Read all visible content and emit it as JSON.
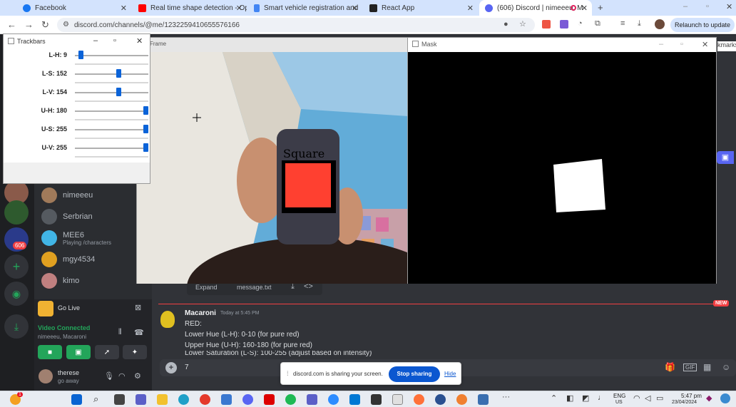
{
  "tabs": [
    {
      "title": "Facebook",
      "color": "#1877f2"
    },
    {
      "title": "Real time shape detection - Op",
      "color": "#ff0000"
    },
    {
      "title": "Smart vehicle registration and",
      "color": "#4285f4"
    },
    {
      "title": "React App",
      "color": "#222222"
    },
    {
      "title": "(606) Discord | nimeeeu, M",
      "color": "#5865f2"
    }
  ],
  "browser": {
    "url": "discord.com/channels/@me/1232259410655576166",
    "relaunch_label": "Relaunch to update",
    "bookmarks_label": "kmarks"
  },
  "trackbars": {
    "title": "Trackbars",
    "items": [
      {
        "label": "L-H: 9",
        "fraction": 0.05
      },
      {
        "label": "L-S: 152",
        "fraction": 0.6
      },
      {
        "label": "L-V: 154",
        "fraction": 0.6
      },
      {
        "label": "U-H: 180",
        "fraction": 1.0
      },
      {
        "label": "U-S: 255",
        "fraction": 1.0
      },
      {
        "label": "U-V: 255",
        "fraction": 1.0
      }
    ]
  },
  "frame_window": {
    "title": "Frame",
    "overlay_text": "Square"
  },
  "mask_window": {
    "title": "Mask"
  },
  "discord": {
    "unread_badge": "606",
    "dms": [
      {
        "name": "nimeeeu",
        "sub": ""
      },
      {
        "name": "Serbrian",
        "sub": ""
      },
      {
        "name": "MEE6",
        "sub": "Playing /characters"
      },
      {
        "name": "mgy4534",
        "sub": ""
      },
      {
        "name": "kimo",
        "sub": ""
      }
    ],
    "go_live": "Go Live",
    "video_connected": "Video Connected",
    "voice_channel": "nimeeeu, Macaroni",
    "user": {
      "name": "therese",
      "status": "go away"
    },
    "attachment": {
      "expand": "Expand",
      "filename": "message.txt"
    },
    "new_badge": "NEW",
    "message": {
      "author": "Macaroni",
      "timestamp": "Today at 5:45 PM",
      "lines": [
        "RED:",
        "Lower Hue (L-H): 0-10 (for pure red)",
        "Upper Hue (U-H): 160-180 (for pure red)",
        "Lower Saturation (L-S): 100-255 (adjust based on intensity)"
      ]
    },
    "input_value": "7",
    "share_text": "discord.com is sharing your screen.",
    "stop_sharing": "Stop sharing",
    "hide": "Hide"
  },
  "taskbar": {
    "lang": "ENG",
    "region": "US",
    "time": "5:47 pm",
    "date": "23/04/2024",
    "notification_count": "1"
  },
  "colors": {
    "accent": "#5865f2",
    "green": "#23a55a",
    "trackbar_thumb": "#0b63d8",
    "red_square": "#ff4030"
  }
}
